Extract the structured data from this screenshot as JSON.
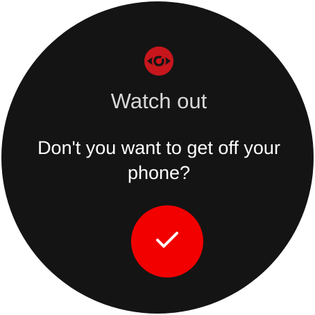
{
  "dialog": {
    "title": "Watch out",
    "message": "Don't you want to get off your phone?",
    "icon": "eye-target-icon",
    "confirm_icon": "checkmark-icon"
  },
  "colors": {
    "background": "#141414",
    "accent": "#f20000",
    "icon_red": "#c8161d",
    "title_text": "#d8d8d8",
    "body_text": "#ffffff"
  }
}
